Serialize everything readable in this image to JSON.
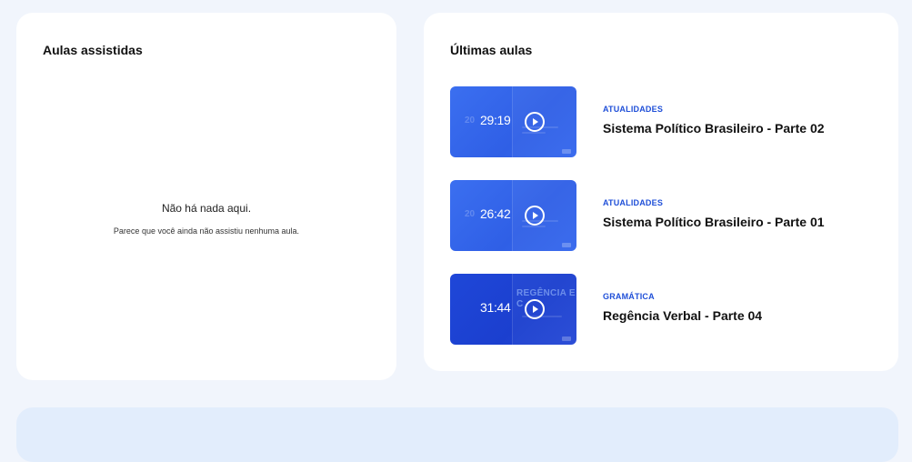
{
  "watched": {
    "title": "Aulas assistidas",
    "empty_title": "Não há nada aqui.",
    "empty_subtitle": "Parece que você ainda não assistiu nenhuma aula."
  },
  "latest": {
    "title": "Últimas aulas",
    "lessons": [
      {
        "duration": "29:19",
        "category": "ATUALIDADES",
        "title": "Sistema Político Brasileiro - Parte 02"
      },
      {
        "duration": "26:42",
        "category": "ATUALIDADES",
        "title": "Sistema Político Brasileiro - Parte 01"
      },
      {
        "duration": "31:44",
        "category": "GRAMÁTICA",
        "title": "Regência Verbal - Parte 04",
        "thumb_text": "REGÊNCIA E C"
      }
    ]
  },
  "colors": {
    "accent": "#1f4fd8",
    "thumb_blue": "#3366ee",
    "background": "#f1f5fc",
    "bottom_panel": "#e2edfc"
  },
  "icons": {
    "play": "play-circle-icon"
  }
}
